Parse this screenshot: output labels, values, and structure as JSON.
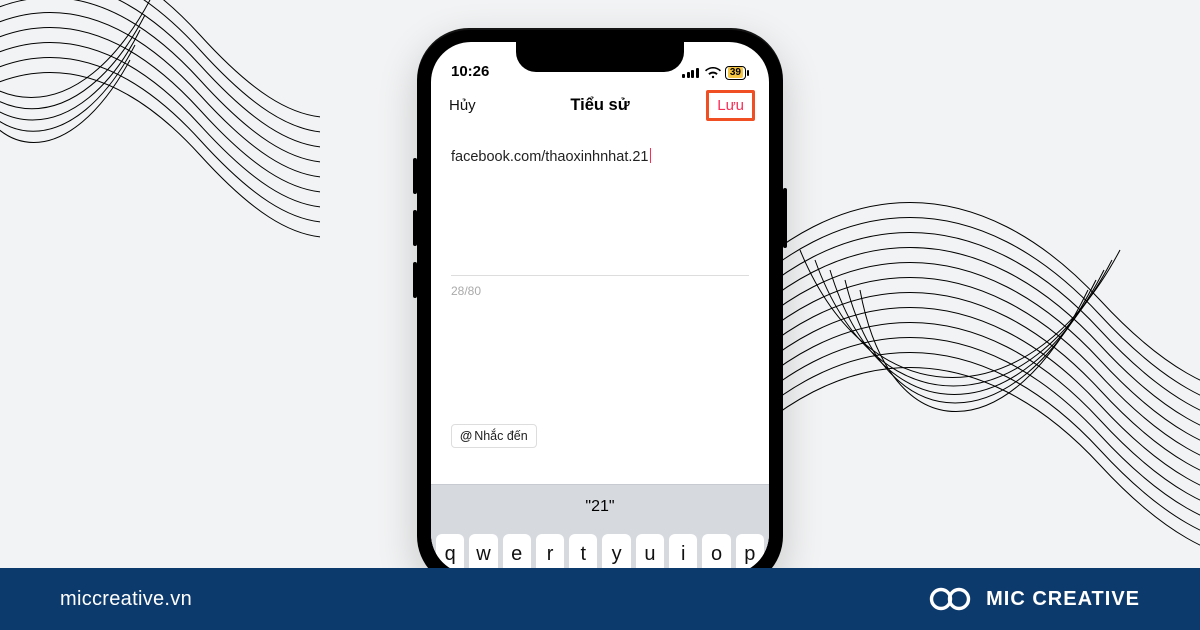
{
  "status": {
    "time": "10:26",
    "battery_level": "39"
  },
  "nav": {
    "cancel": "Hủy",
    "title": "Tiểu sử",
    "save": "Lưu"
  },
  "bio": {
    "value": "facebook.com/thaoxinhnhat.21",
    "count": "28/80"
  },
  "mention": {
    "label": "Nhắc đến",
    "at": "@"
  },
  "keyboard": {
    "suggestion": "\"21\"",
    "row1": [
      "q",
      "w",
      "e",
      "r",
      "t",
      "y",
      "u",
      "i",
      "o",
      "p"
    ]
  },
  "footer": {
    "domain": "miccreative.vn",
    "brand": "MIC CREATIVE"
  }
}
